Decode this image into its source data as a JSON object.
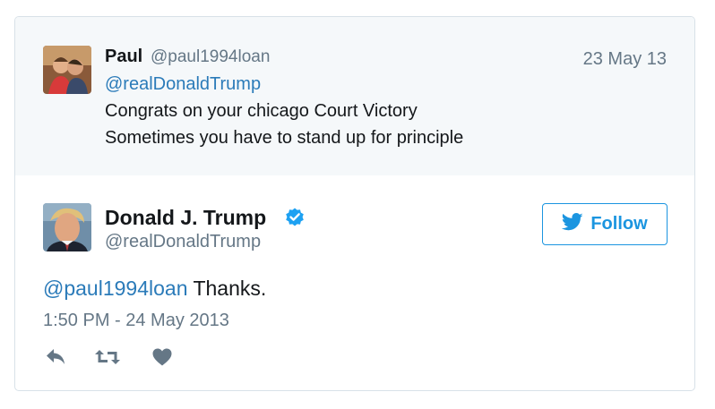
{
  "quoted_tweet": {
    "name": "Paul",
    "handle": "@paul1994loan",
    "date": "23 May 13",
    "mention": "@realDonaldTrump",
    "lines": [
      "Congrats on your chicago Court Victory",
      "Sometimes you have to stand up for principle"
    ]
  },
  "tweet": {
    "name": "Donald J. Trump",
    "handle": "@realDonaldTrump",
    "follow_label": "Follow",
    "mention": "@paul1994loan",
    "text": " Thanks.",
    "timestamp": "1:50 PM - 24 May 2013"
  },
  "colors": {
    "accent": "#1b95e0",
    "link": "#2b7bb9",
    "muted": "#657786",
    "icon": "#657786"
  },
  "icons": [
    "avatar",
    "verified-icon",
    "twitter-bird-icon",
    "reply-icon",
    "retweet-icon",
    "like-icon"
  ]
}
